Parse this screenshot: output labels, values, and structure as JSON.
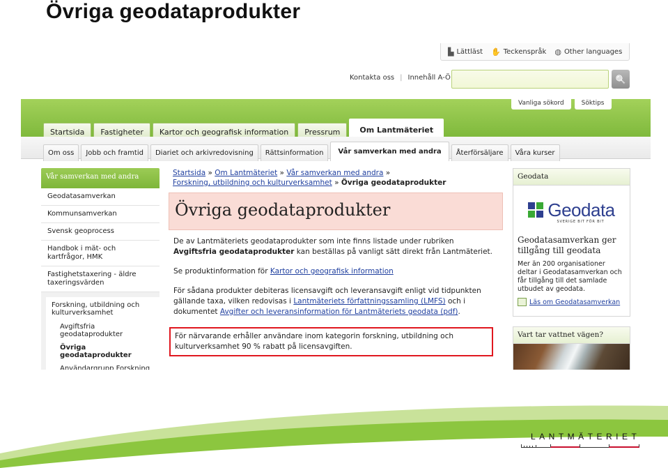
{
  "slide": {
    "title": "Övriga geodataprodukter"
  },
  "logo": {
    "text": "LANTMÄTERIET"
  },
  "toplinks": [
    {
      "icon": "easy-read-icon",
      "glyph": "▙",
      "label": "Lättläst"
    },
    {
      "icon": "sign-language-icon",
      "glyph": "✋",
      "label": "Teckenspråk"
    },
    {
      "icon": "globe-icon",
      "glyph": "◍",
      "label": "Other languages"
    }
  ],
  "util": {
    "contact": "Kontakta oss",
    "index": "Innehåll A-Ö",
    "separator": "|"
  },
  "search": {
    "placeholder": "",
    "value": "",
    "button_glyph": "🔍"
  },
  "search_tabs": [
    "Vanliga sökord",
    "Söktips"
  ],
  "main_tabs": [
    {
      "label": "Startsida",
      "active": false
    },
    {
      "label": "Fastigheter",
      "active": false
    },
    {
      "label": "Kartor och geografisk information",
      "active": false
    },
    {
      "label": "Pressrum",
      "active": false
    },
    {
      "label": "Om Lantmäteriet",
      "active": true
    }
  ],
  "sub_tabs": [
    {
      "label": "Om oss",
      "active": false
    },
    {
      "label": "Jobb och framtid",
      "active": false
    },
    {
      "label": "Diariet och arkivredovisning",
      "active": false
    },
    {
      "label": "Rättsinformation",
      "active": false
    },
    {
      "label": "Vår samverkan med andra",
      "active": true
    },
    {
      "label": "Återförsäljare",
      "active": false
    },
    {
      "label": "Våra kurser",
      "active": false
    }
  ],
  "leftnav": {
    "heading": "Vår samverkan med andra",
    "items": [
      "Geodatasamverkan",
      "Kommunsamverkan",
      "Svensk geoprocess",
      "Handbok i mät- och kartfrågor, HMK",
      "Fastighetstaxering - äldre taxeringsvärden"
    ],
    "group_title": "Forskning, utbildning och kulturverksamhet",
    "group_items": [
      {
        "label": "Avgiftsfria geodataprodukter",
        "bold": false
      },
      {
        "label": "Övriga geodataprodukter",
        "bold": true
      },
      {
        "label": "Användargrupp Forskning och utbildning",
        "bold": false
      }
    ]
  },
  "breadcrumb": {
    "links": [
      "Startsida",
      "Om Lantmäteriet",
      "Vår samverkan med andra",
      "Forskning, utbildning och kulturverksamhet"
    ],
    "separator": "»",
    "current": "Övriga geodataprodukter"
  },
  "main": {
    "heading": "Övriga geodataprodukter",
    "p1_pre": "De av Lantmäteriets geodataprodukter som inte finns listade under rubriken ",
    "p1_bold": "Avgiftsfria geodataprodukter",
    "p1_post": " kan beställas på vanligt sätt direkt från Lantmäteriet.",
    "p2_pre": "Se produktinformation för ",
    "p2_link": "Kartor och geografisk information",
    "p3_pre": "För sådana produkter debiteras licensavgift och leveransavgift enligt vid tidpunkten gällande taxa, vilken redovisas i ",
    "p3_link1": "Lantmäteriets författningssamling (LMFS)",
    "p3_mid": " och i dokumentet ",
    "p3_link2": "Avgifter och leveransinformation för Lantmäteriets geodata (pdf)",
    "p3_post": ".",
    "highlight": "För närvarande erhåller användare inom kategorin forskning, utbildning och kulturverksamhet 90 % rabatt på licensavgiften."
  },
  "geodata_box": {
    "heading": "Geodata",
    "logo_word": "Geodata",
    "logo_tagline": "SVERIGE BIT FÖR BIT",
    "title": "Geodatasamverkan ger tillgång till geodata",
    "text": "Mer än 200 organisationer deltar i Geodatasamverkan och får tillgång till det samlade utbudet av geodata.",
    "link": "Läs om Geodatasamverkan"
  },
  "water_box": {
    "heading": "Vart tar vattnet vägen?"
  },
  "colors": {
    "green": "#8cc63f",
    "red_highlight": "#e0171f",
    "link_blue": "#1f3f9f",
    "geodata_blue": "#2e3f8f",
    "geodata_green": "#3aa935"
  }
}
